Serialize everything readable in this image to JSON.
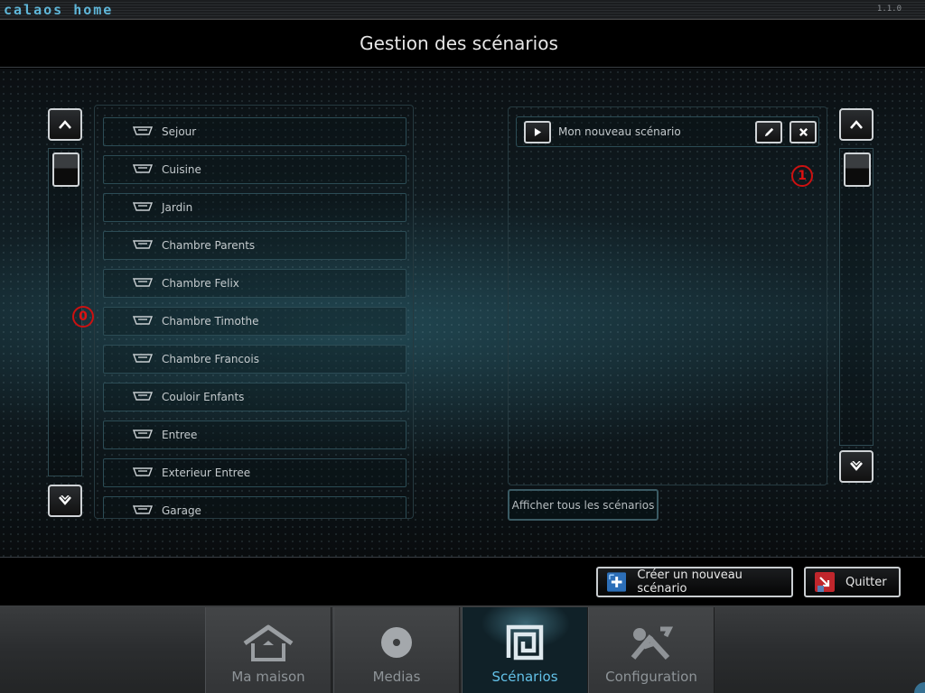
{
  "app": {
    "logo": "calaos home",
    "version": "1.1.0"
  },
  "header": {
    "title": "Gestion des scénarios"
  },
  "left_marker": "0",
  "right_marker": "1",
  "rooms": [
    {
      "label": "Sejour"
    },
    {
      "label": "Cuisine"
    },
    {
      "label": "Jardin"
    },
    {
      "label": "Chambre Parents"
    },
    {
      "label": "Chambre Felix"
    },
    {
      "label": "Chambre Timothe"
    },
    {
      "label": "Chambre Francois"
    },
    {
      "label": "Couloir Enfants"
    },
    {
      "label": "Entree"
    },
    {
      "label": "Exterieur Entree"
    },
    {
      "label": "Garage"
    }
  ],
  "scenarios": [
    {
      "name": "Mon nouveau scénario"
    }
  ],
  "show_all_label": "Afficher tous les scénarios",
  "actions": {
    "create_label": "Créer un nouveau scénario",
    "quit_label": "Quitter"
  },
  "nav": [
    {
      "label": "Ma maison",
      "icon": "house-icon",
      "active": false
    },
    {
      "label": "Medias",
      "icon": "disc-icon",
      "active": false
    },
    {
      "label": "Scénarios",
      "icon": "scenario-icon",
      "active": true
    },
    {
      "label": "Configuration",
      "icon": "tools-icon",
      "active": false
    }
  ],
  "colors": {
    "accent": "#63c1e8",
    "marker": "#cc1111",
    "text": "#c4cacd"
  }
}
